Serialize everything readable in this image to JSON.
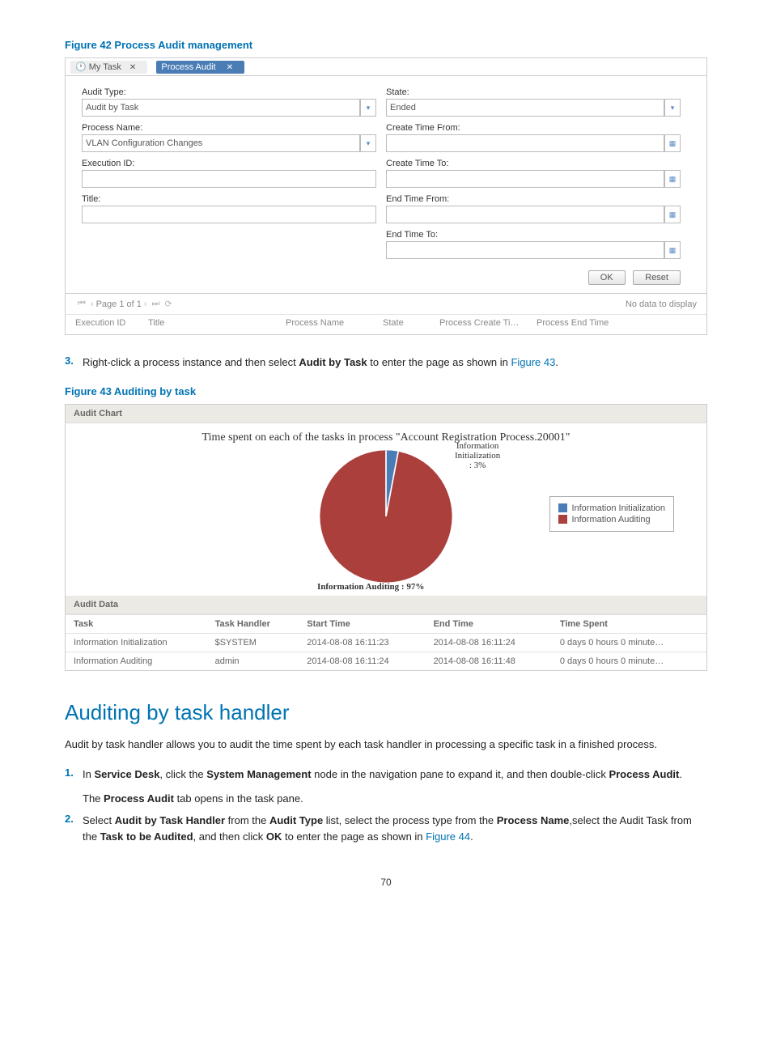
{
  "fig42": {
    "caption": "Figure 42 Process Audit management",
    "tabs": {
      "my_task": "My Task",
      "process_audit": "Process Audit"
    },
    "left": {
      "audit_type_lbl": "Audit Type:",
      "audit_type_val": "Audit by Task",
      "process_name_lbl": "Process Name:",
      "process_name_val": "VLAN Configuration Changes",
      "execution_id_lbl": "Execution ID:",
      "title_lbl": "Title:"
    },
    "right": {
      "state_lbl": "State:",
      "state_val": "Ended",
      "create_from_lbl": "Create Time From:",
      "create_to_lbl": "Create Time To:",
      "end_from_lbl": "End Time From:",
      "end_to_lbl": "End Time To:",
      "ok": "OK",
      "reset": "Reset"
    },
    "pager": {
      "page": "Page 1",
      "of": "of 1",
      "nodata": "No data to display"
    },
    "cols": {
      "exec": "Execution ID",
      "title": "Title",
      "pname": "Process Name",
      "state": "State",
      "ctime": "Process Create Ti…",
      "etime": "Process End Time"
    }
  },
  "step3": {
    "num": "3.",
    "pre": "Right-click a process instance and then select ",
    "bold": "Audit by Task",
    "mid": " to enter the page as shown in ",
    "link": "Figure 43",
    "post": "."
  },
  "fig43": {
    "caption": "Figure 43 Auditing by task",
    "chart_panel": "Audit Chart",
    "data_panel": "Audit Data",
    "chart_title": "Time spent on each of the tasks in process \"Account Registration Process.20001\"",
    "slice1": "Information Initialization : 3%",
    "slice2": "Information Auditing : 97%",
    "legend1": "Information Initialization",
    "legend2": "Information Auditing",
    "tbl": {
      "h": {
        "task": "Task",
        "handler": "Task Handler",
        "start": "Start Time",
        "end": "End Time",
        "spent": "Time Spent"
      },
      "r1": {
        "task": "Information Initialization",
        "handler": "$SYSTEM",
        "start": "2014-08-08 16:11:23",
        "end": "2014-08-08 16:11:24",
        "spent": "0 days 0 hours 0 minute…"
      },
      "r2": {
        "task": "Information Auditing",
        "handler": "admin",
        "start": "2014-08-08 16:11:24",
        "end": "2014-08-08 16:11:48",
        "spent": "0 days 0 hours 0 minute…"
      }
    }
  },
  "chart_data": {
    "type": "pie",
    "title": "Time spent on each of the tasks in process \"Account Registration Process.20001\"",
    "series": [
      {
        "name": "Information Initialization",
        "value": 3,
        "color": "#4a7cb5"
      },
      {
        "name": "Information Auditing",
        "value": 97,
        "color": "#aa3f3c"
      }
    ]
  },
  "section": "Auditing by task handler",
  "intro": "Audit by task handler allows you to audit the time spent by each task handler in processing a specific task in a finished process.",
  "step1": {
    "num": "1.",
    "t1": "In ",
    "b1": "Service Desk",
    "t2": ", click the ",
    "b2": "System Management",
    "t3": " node in the navigation pane to expand it, and then double-click ",
    "b3": "Process Audit",
    "t4": ".",
    "line2a": "The ",
    "line2b": "Process Audit",
    "line2c": " tab opens in the task pane."
  },
  "step2": {
    "num": "2.",
    "t1": "Select ",
    "b1": "Audit by Task Handler",
    "t2": " from the ",
    "b2": "Audit Type",
    "t3": " list, select the process type from the ",
    "b3": "Process Name",
    "t4": ",select the Audit Task from the ",
    "b4": "Task to be Audited",
    "t5": ", and then click ",
    "b5": "OK",
    "t6": " to enter the page as shown in ",
    "link": "Figure 44",
    "t7": "."
  },
  "page": "70"
}
